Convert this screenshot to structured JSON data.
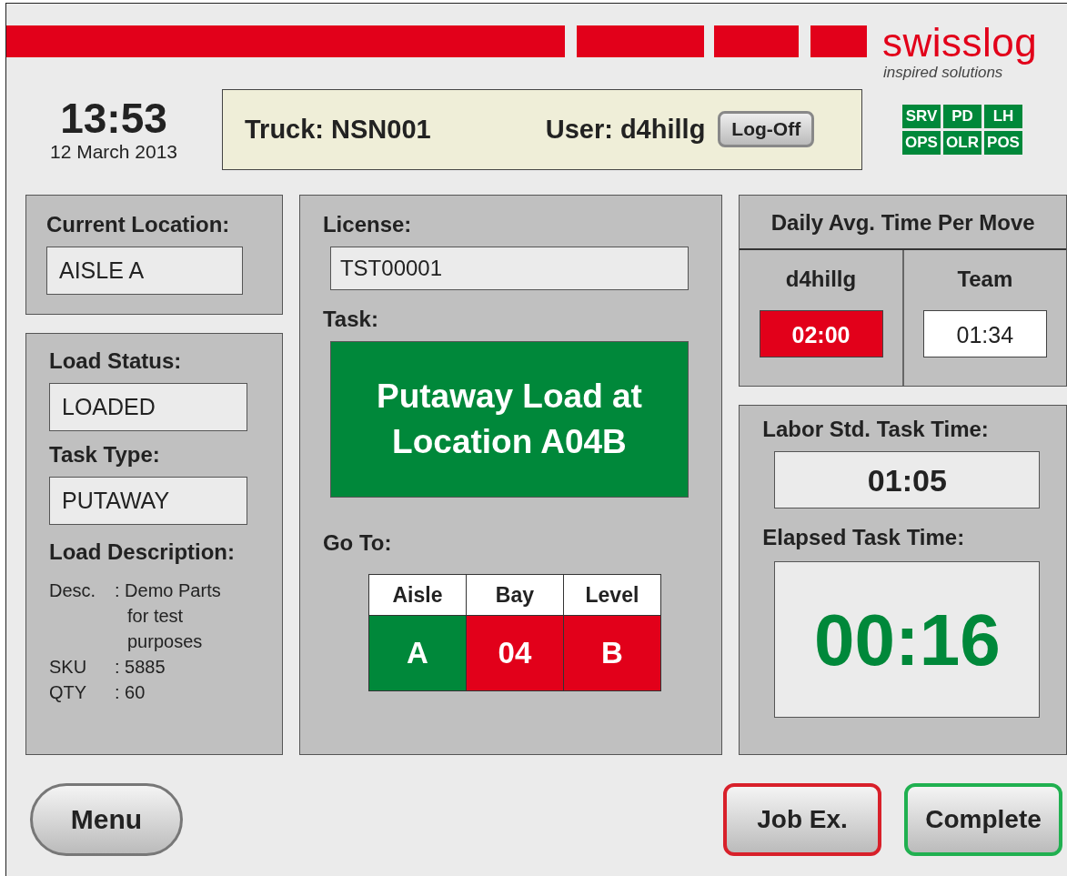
{
  "brand": {
    "name": "swisslog",
    "tagline": "inspired solutions"
  },
  "clock": {
    "time": "13:53",
    "date": "12 March 2013"
  },
  "session": {
    "truck_label": "Truck:",
    "truck": "NSN001",
    "user_label": "User:",
    "user": "d4hillg",
    "logoff": "Log-Off"
  },
  "status_badges": [
    {
      "label": "SRV",
      "on": true
    },
    {
      "label": "PD",
      "on": true
    },
    {
      "label": "LH",
      "on": true
    },
    {
      "label": "OPS",
      "on": true
    },
    {
      "label": "OLR",
      "on": true
    },
    {
      "label": "POS",
      "on": true
    }
  ],
  "current_location": {
    "label": "Current Location:",
    "value": "AISLE A"
  },
  "load": {
    "status_label": "Load Status:",
    "status": "LOADED",
    "type_label": "Task Type:",
    "type": "PUTAWAY",
    "desc_label": "Load Description:",
    "details": [
      {
        "key": "Desc.",
        "value": ": Demo  Parts",
        "more": [
          "for test",
          "purposes"
        ]
      },
      {
        "key": "SKU",
        "value": ": 5885"
      },
      {
        "key": "QTY",
        "value": ": 60"
      }
    ]
  },
  "task": {
    "license_label": "License:",
    "license": "TST00001",
    "task_label": "Task:",
    "task_lines": [
      "Putaway Load at",
      "Location A04B"
    ],
    "goto_label": "Go To:",
    "goto": [
      {
        "heading": "Aisle",
        "value": "A",
        "color": "#00883a"
      },
      {
        "heading": "Bay",
        "value": "04",
        "color": "#e2001a"
      },
      {
        "heading": "Level",
        "value": "B",
        "color": "#e2001a"
      }
    ]
  },
  "daily_avg": {
    "title": "Daily Avg. Time Per Move",
    "columns": [
      {
        "name": "d4hillg",
        "value": "02:00",
        "alert": true
      },
      {
        "name": "Team",
        "value": "01:34",
        "alert": false
      }
    ]
  },
  "times": {
    "labor_label": "Labor Std. Task Time:",
    "labor": "01:05",
    "elapsed_label": "Elapsed Task Time:",
    "elapsed": "00:16"
  },
  "buttons": [
    {
      "label": "Menu",
      "kind": "pill"
    },
    {
      "label": "Job Ex.",
      "kind": "danger"
    },
    {
      "label": "Complete",
      "kind": "confirm"
    }
  ]
}
